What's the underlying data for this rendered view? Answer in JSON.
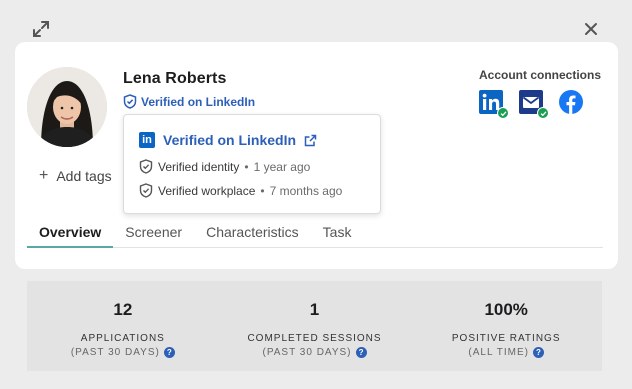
{
  "profile": {
    "name": "Lena Roberts",
    "verified_label": "Verified on LinkedIn",
    "add_tags_label": "Add tags"
  },
  "popover": {
    "title": "Verified on LinkedIn",
    "rows": [
      {
        "label": "Verified identity",
        "time": "1 year ago"
      },
      {
        "label": "Verified workplace",
        "time": "7 months ago"
      }
    ],
    "separator": "•"
  },
  "accounts": {
    "title": "Account connections",
    "items": [
      {
        "icon": "linkedin-icon",
        "verified": true,
        "color": "#0a66c2"
      },
      {
        "icon": "email-icon",
        "verified": true,
        "color": "#1e3a8a"
      },
      {
        "icon": "facebook-icon",
        "verified": false,
        "color": "#1877f2"
      }
    ]
  },
  "tabs": [
    {
      "label": "Overview",
      "active": true
    },
    {
      "label": "Screener",
      "active": false
    },
    {
      "label": "Characteristics",
      "active": false
    },
    {
      "label": "Task",
      "active": false
    }
  ],
  "stats": [
    {
      "value": "12",
      "label": "APPLICATIONS",
      "sub": "(PAST 30 DAYS)"
    },
    {
      "value": "1",
      "label": "COMPLETED SESSIONS",
      "sub": "(PAST 30 DAYS)"
    },
    {
      "value": "100%",
      "label": "POSITIVE RATINGS",
      "sub": "(ALL TIME)"
    }
  ],
  "colors": {
    "link": "#2c5fb8",
    "tab_underline": "#5aa7a3",
    "verified_check": "#1a9e52"
  }
}
